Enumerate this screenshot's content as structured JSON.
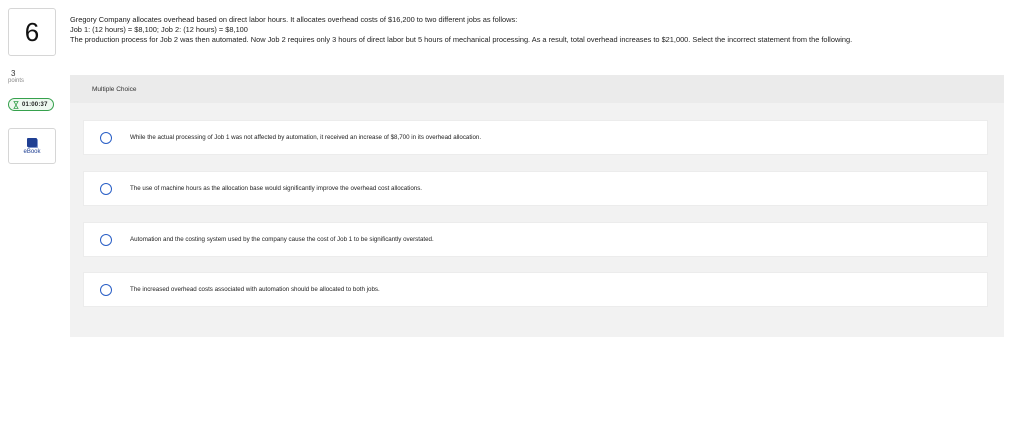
{
  "sidebar": {
    "question_number": "6",
    "points_value": "3",
    "points_label": "points",
    "timer": "01:00:37",
    "ebook_label": "eBook"
  },
  "question": {
    "line1": "Gregory Company allocates overhead based on direct labor hours. It allocates overhead costs of $16,200 to two different jobs as follows:",
    "line2": "Job 1: (12 hours) = $8,100; Job 2: (12 hours) = $8,100",
    "line3": "The production process for Job 2 was then automated. Now Job 2 requires only 3 hours of direct labor but 5 hours of mechanical processing. As a result, total overhead increases to $21,000. Select the incorrect statement from the following."
  },
  "answer_panel": {
    "title": "Multiple Choice",
    "options": [
      "While the actual processing of Job 1 was not affected by automation, it received an increase of $8,700 in its overhead allocation.",
      "The use of machine hours as the allocation base would significantly improve the overhead cost allocations.",
      "Automation and the costing system used by the company cause the cost of Job 1 to be significantly overstated.",
      "The increased overhead costs associated with automation should be allocated to both jobs."
    ]
  },
  "colors": {
    "radio_border": "#2a5fc6",
    "timer_border": "#36a14d",
    "ebook_icon": "#1f3f93",
    "panel_bg": "#f2f2f2"
  }
}
